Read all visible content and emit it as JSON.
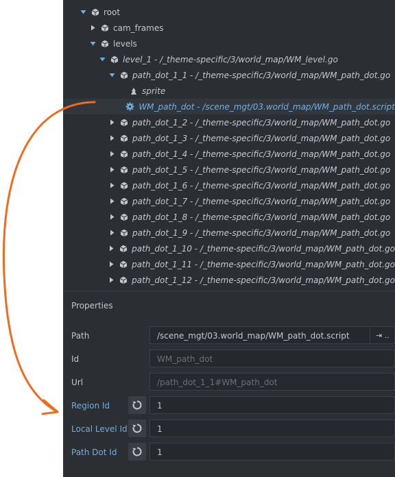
{
  "outline": {
    "rows": [
      {
        "label": "root",
        "italic": false,
        "expanded": true,
        "selected": false,
        "icon": "gameobject-icon"
      },
      {
        "label": "cam_frames",
        "italic": false,
        "expanded": false,
        "selected": false,
        "icon": "gameobject-icon"
      },
      {
        "label": "levels",
        "italic": false,
        "expanded": true,
        "selected": false,
        "icon": "gameobject-icon"
      },
      {
        "label": "level_1 - /_theme-specific/3/world_map/WM_level.go",
        "italic": true,
        "expanded": true,
        "selected": false,
        "icon": "gameobject-icon"
      },
      {
        "label": "path_dot_1_1 - /_theme-specific/3/world_map/WM_path_dot.go",
        "italic": true,
        "expanded": true,
        "selected": false,
        "icon": "gameobject-icon"
      },
      {
        "label": "sprite",
        "italic": true,
        "expanded": null,
        "selected": false,
        "icon": "sprite-icon"
      },
      {
        "label": "WM_path_dot - /scene_mgt/03.world_map/WM_path_dot.script",
        "italic": true,
        "expanded": null,
        "selected": true,
        "icon": "gear-icon"
      },
      {
        "label": "path_dot_1_2 - /_theme-specific/3/world_map/WM_path_dot.go",
        "italic": true,
        "expanded": false,
        "selected": false,
        "icon": "gameobject-icon"
      },
      {
        "label": "path_dot_1_3 - /_theme-specific/3/world_map/WM_path_dot.go",
        "italic": true,
        "expanded": false,
        "selected": false,
        "icon": "gameobject-icon"
      },
      {
        "label": "path_dot_1_4 - /_theme-specific/3/world_map/WM_path_dot.go",
        "italic": true,
        "expanded": false,
        "selected": false,
        "icon": "gameobject-icon"
      },
      {
        "label": "path_dot_1_5 - /_theme-specific/3/world_map/WM_path_dot.go",
        "italic": true,
        "expanded": false,
        "selected": false,
        "icon": "gameobject-icon"
      },
      {
        "label": "path_dot_1_6 - /_theme-specific/3/world_map/WM_path_dot.go",
        "italic": true,
        "expanded": false,
        "selected": false,
        "icon": "gameobject-icon"
      },
      {
        "label": "path_dot_1_7 - /_theme-specific/3/world_map/WM_path_dot.go",
        "italic": true,
        "expanded": false,
        "selected": false,
        "icon": "gameobject-icon"
      },
      {
        "label": "path_dot_1_8 - /_theme-specific/3/world_map/WM_path_dot.go",
        "italic": true,
        "expanded": false,
        "selected": false,
        "icon": "gameobject-icon"
      },
      {
        "label": "path_dot_1_9 - /_theme-specific/3/world_map/WM_path_dot.go",
        "italic": true,
        "expanded": false,
        "selected": false,
        "icon": "gameobject-icon"
      },
      {
        "label": "path_dot_1_10 - /_theme-specific/3/world_map/WM_path_dot.go",
        "italic": true,
        "expanded": false,
        "selected": false,
        "icon": "gameobject-icon"
      },
      {
        "label": "path_dot_1_11 - /_theme-specific/3/world_map/WM_path_dot.go",
        "italic": true,
        "expanded": false,
        "selected": false,
        "icon": "gameobject-icon"
      },
      {
        "label": "path_dot_1_12 - /_theme-specific/3/world_map/WM_path_dot.go",
        "italic": true,
        "expanded": false,
        "selected": false,
        "icon": "gameobject-icon"
      }
    ]
  },
  "properties": {
    "title": "Properties",
    "path": {
      "label": "Path",
      "value": "/scene_mgt/03.world_map/WM_path_dot.script",
      "button": "⇥ .."
    },
    "id": {
      "label": "Id",
      "value": "WM_path_dot"
    },
    "url": {
      "label": "Url",
      "value": "/path_dot_1_1#WM_path_dot"
    },
    "region_id": {
      "label": "Region Id",
      "value": "1"
    },
    "local_level_id": {
      "label": "Local Level Id",
      "value": "1"
    },
    "path_dot_id": {
      "label": "Path Dot Id",
      "value": "1"
    }
  },
  "colors": {
    "panel_bg": "#2b2e33",
    "text": "#c3c7cc",
    "accent_blue": "#6ab0e8",
    "annotation_arrow": "#f26b1d"
  }
}
